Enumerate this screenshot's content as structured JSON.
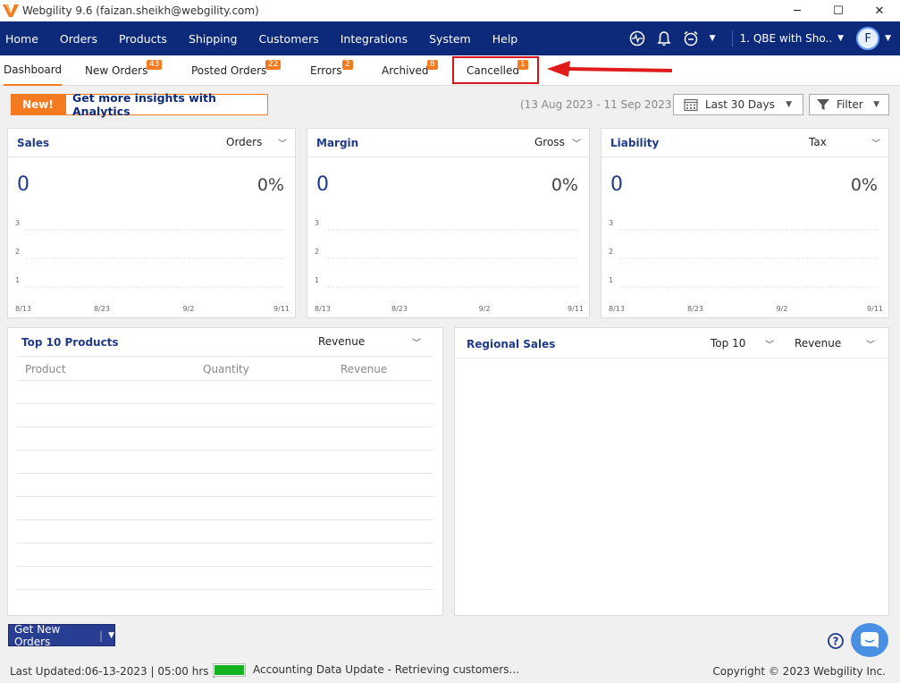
{
  "window": {
    "title": "Webgility 9.6 (faizan.sheikh@webgility.com)",
    "controls": [
      "─",
      "☐",
      "✕"
    ]
  },
  "nav": {
    "items": [
      "Home",
      "Orders",
      "Products",
      "Shipping",
      "Customers",
      "Integrations",
      "System",
      "Help"
    ],
    "store": "1. QBE with Sho..",
    "user_initial": "F"
  },
  "tabs": [
    {
      "label": "Dashboard",
      "badge": ""
    },
    {
      "label": "New Orders",
      "badge": "43"
    },
    {
      "label": "Posted Orders",
      "badge": "22"
    },
    {
      "label": "Errors",
      "badge": "2"
    },
    {
      "label": "Archived",
      "badge": "8"
    },
    {
      "label": "Cancelled",
      "badge": "1"
    }
  ],
  "toolbar": {
    "new_label": "New!",
    "analytics_label": "Get more insights with Analytics",
    "date_range": "(13 Aug 2023 - 11 Sep 2023)",
    "period": "Last 30 Days",
    "filter": "Filter"
  },
  "cards": [
    {
      "title": "Sales",
      "option": "Orders",
      "value": "0",
      "percent": "0%"
    },
    {
      "title": "Margin",
      "option": "Gross",
      "value": "0",
      "percent": "0%"
    },
    {
      "title": "Liability",
      "option": "Tax",
      "value": "0",
      "percent": "0%"
    }
  ],
  "chart_data": {
    "type": "line",
    "x": [
      "8/13",
      "8/23",
      "9/2",
      "9/11"
    ],
    "y_ticks": [
      "3",
      "2",
      "1"
    ],
    "series": []
  },
  "top_products": {
    "title": "Top 10 Products",
    "option": "Revenue",
    "columns": [
      "Product",
      "Quantity",
      "Revenue"
    ]
  },
  "regional": {
    "title": "Regional Sales",
    "option1": "Top 10",
    "option2": "Revenue"
  },
  "get_new_orders": "Get New Orders",
  "status": {
    "last_updated": "Last Updated:06-13-2023 | 05:00 hrs |",
    "progress_fraction": 1.0,
    "message": "Accounting Data Update - Retrieving customers...",
    "copyright": "Copyright © 2023 Webgility Inc."
  },
  "colors": {
    "nav_bg": "#0d2a7a",
    "accent": "#f47b20",
    "highlight": "#d9131b"
  }
}
